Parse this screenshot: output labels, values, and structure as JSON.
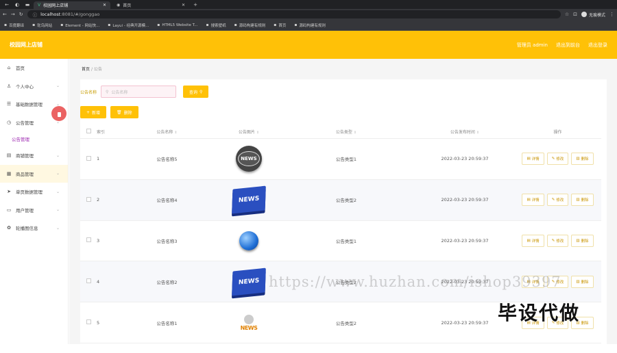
{
  "browser": {
    "tabs": [
      {
        "title": "校园网上店铺",
        "active": true
      },
      {
        "title": "首页",
        "active": false
      }
    ],
    "address": {
      "host": "localhost",
      "path": ":8081/#/gonggao"
    },
    "profile": "无痕模式",
    "bookmarks": [
      "百度翻译",
      "鸵鸟网站",
      "Element - 网站快...",
      "Layui - 经典开源模...",
      "HTML5 Website T...",
      "搜索壁纸",
      "源码构建有规则",
      "首页",
      "源码构建有规则"
    ]
  },
  "header": {
    "logo": "校园网上店铺",
    "links": [
      "管理员 admin",
      "退出到前台",
      "退出登录"
    ]
  },
  "sidebar": {
    "items": [
      {
        "label": "首页",
        "icon": "home-icon",
        "glyph": "⌂",
        "chev": false
      },
      {
        "label": "个人中心",
        "icon": "user-icon",
        "glyph": "♙",
        "chev": true
      },
      {
        "label": "基础数据管理",
        "icon": "database-icon",
        "glyph": "☰",
        "chev": true
      },
      {
        "label": "公告管理",
        "icon": "clock-icon",
        "glyph": "◷",
        "chev": true
      },
      {
        "label": "公告管理",
        "sub": true
      },
      {
        "label": "商铺管理",
        "icon": "shop-icon",
        "glyph": "▤",
        "chev": true
      },
      {
        "label": "商品管理",
        "icon": "grid-icon",
        "glyph": "▦",
        "chev": true,
        "hover": true
      },
      {
        "label": "单页数据管理",
        "icon": "send-icon",
        "glyph": "➤",
        "chev": true
      },
      {
        "label": "用户管理",
        "icon": "users-icon",
        "glyph": "▭",
        "chev": true
      },
      {
        "label": "轮播图信息",
        "icon": "settings-icon",
        "glyph": "✿",
        "chev": true
      }
    ]
  },
  "breadcrumb": {
    "home": "首页",
    "current": "公告"
  },
  "search": {
    "label": "公告名称",
    "placeholder": "公告名称",
    "button": "查询"
  },
  "ops": {
    "add": "新增",
    "delete": "删除"
  },
  "table": {
    "columns": [
      "索引",
      "公告名称",
      "公告图片",
      "公告类型",
      "公告发布时间",
      "操作"
    ],
    "actions": {
      "detail": "详情",
      "edit": "修改",
      "delete": "删除"
    },
    "rows": [
      {
        "index": "1",
        "name": "公告名称5",
        "image": "news-gray",
        "type": "公告类型1",
        "time": "2022-03-23 20:59:37"
      },
      {
        "index": "2",
        "name": "公告名称4",
        "image": "news-blue",
        "type": "公告类型2",
        "time": "2022-03-23 20:59:37"
      },
      {
        "index": "3",
        "name": "公告名称3",
        "image": "news-globe",
        "type": "公告类型1",
        "time": "2022-03-23 20:59:37"
      },
      {
        "index": "4",
        "name": "公告名称2",
        "image": "news-blue",
        "type": "公告类型2",
        "time": "2022-03-23 20:59:37"
      },
      {
        "index": "5",
        "name": "公告名称1",
        "image": "news-chef",
        "type": "公告类型2",
        "time": "2022-03-23 20:59:37"
      }
    ]
  },
  "watermark": "https://www.huzhan.com/ishop39397",
  "overlay_brand": "毕设代做",
  "news_text": "NEWS"
}
